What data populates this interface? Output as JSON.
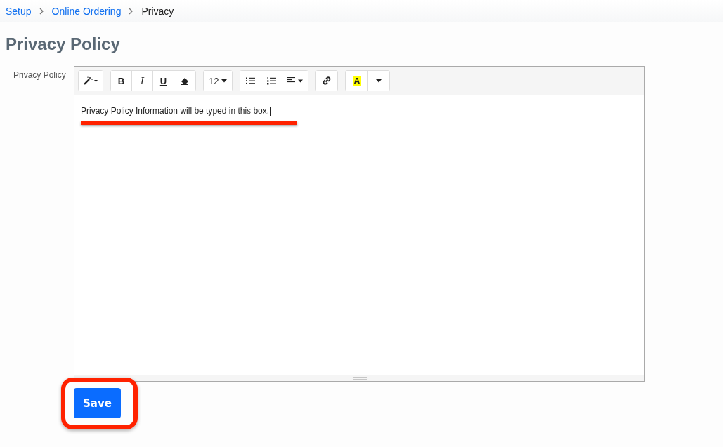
{
  "breadcrumb": [
    {
      "label": "Setup",
      "link": true
    },
    {
      "label": "Online Ordering",
      "link": true
    },
    {
      "label": "Privacy",
      "link": false
    }
  ],
  "title": "Privacy Policy",
  "field": {
    "label": "Privacy Policy",
    "value": "Privacy Policy Information will be typed in this box."
  },
  "toolbar": {
    "bold": "B",
    "italic": "I",
    "underline": "U",
    "font_size": "12",
    "highlight": "A"
  },
  "save_button": "Save"
}
